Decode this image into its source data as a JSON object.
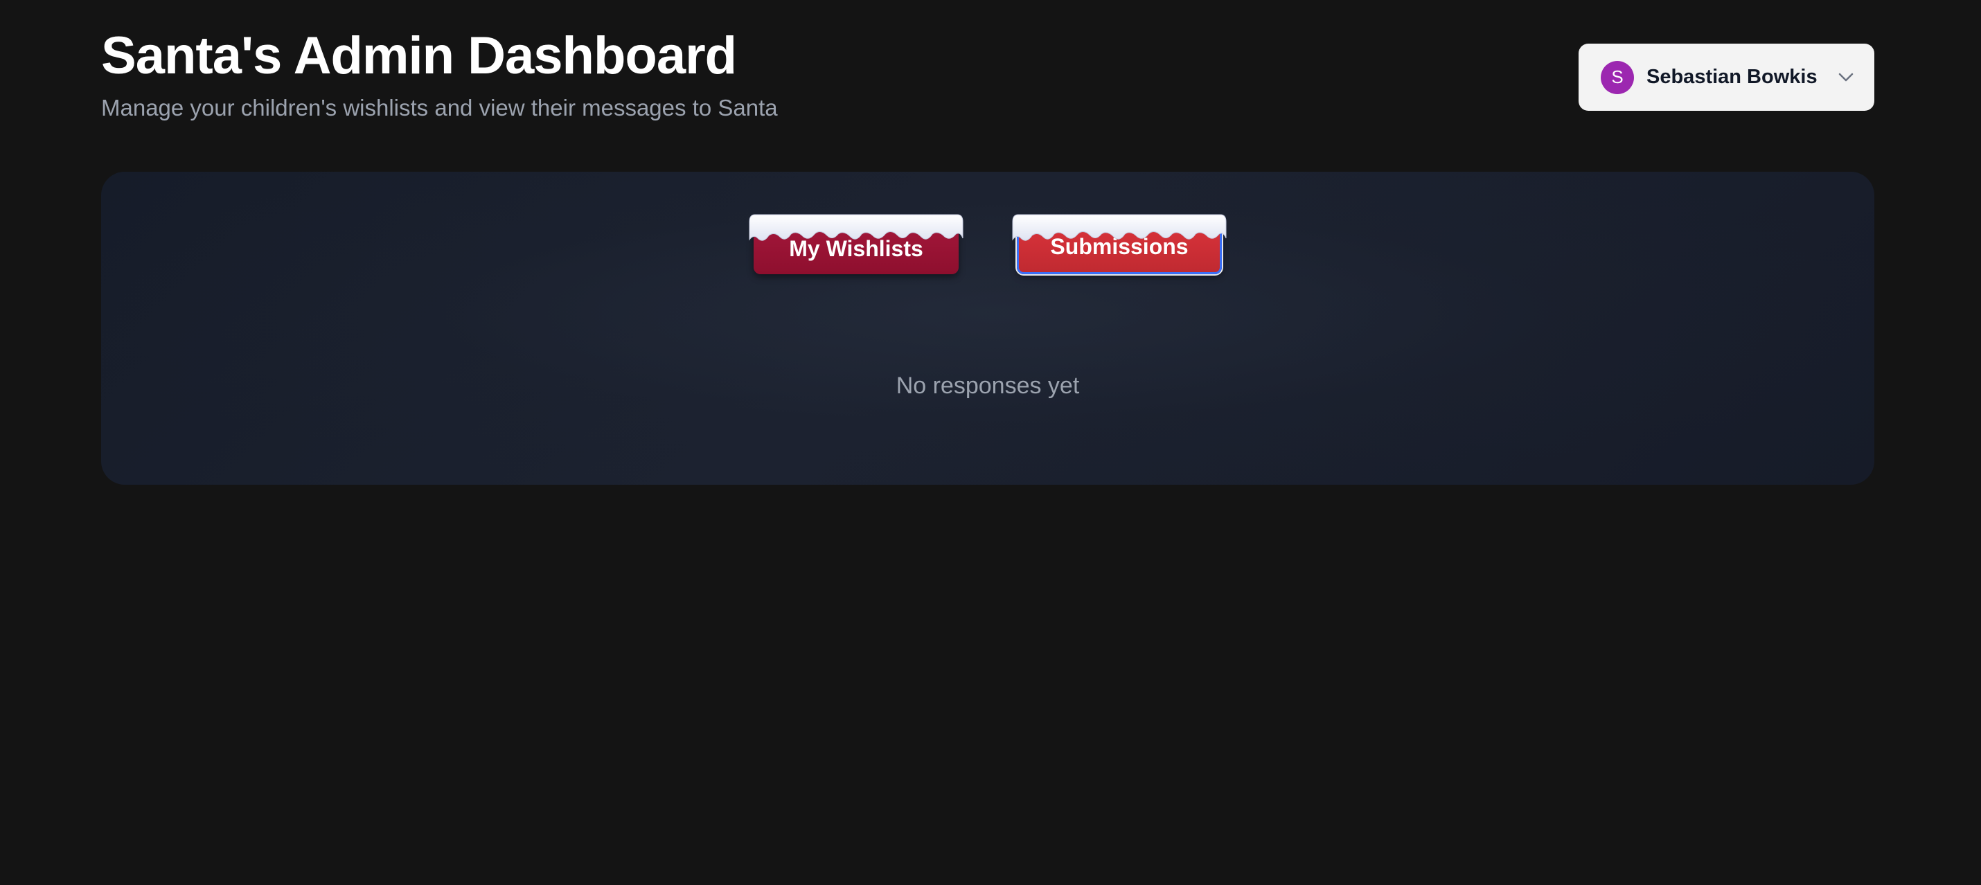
{
  "header": {
    "title": "Santa's Admin Dashboard",
    "subtitle": "Manage your children's wishlists and view their messages to Santa"
  },
  "user_menu": {
    "avatar_initial": "S",
    "avatar_color": "#9c27b0",
    "name": "Sebastian Bowkis",
    "icon": "chevron-down-icon"
  },
  "tabs": [
    {
      "label": "My Wishlists",
      "active": false
    },
    {
      "label": "Submissions",
      "active": true
    }
  ],
  "main": {
    "empty_message": "No responses yet"
  },
  "colors": {
    "background": "#141414",
    "panel": "#1a2030",
    "tab_red": "#c02a31",
    "tab_dark_red": "#8e0f2e",
    "focus_ring": "#3b6ff5"
  }
}
